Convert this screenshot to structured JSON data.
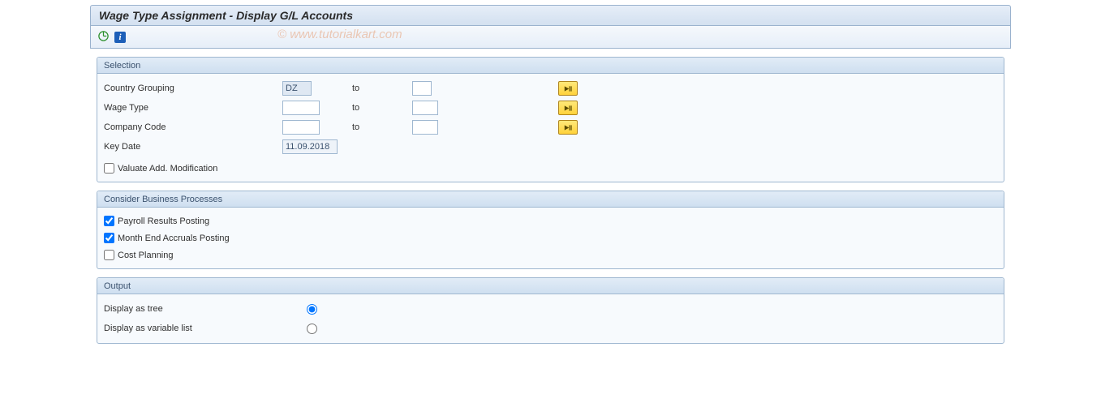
{
  "title": "Wage Type Assignment - Display G/L Accounts",
  "watermark": "© www.tutorialkart.com",
  "toolbar": {
    "execute_icon": "execute",
    "info_icon": "i"
  },
  "groups": {
    "selection": {
      "heading": "Selection",
      "fields": {
        "country_grouping": {
          "label": "Country Grouping",
          "from": "DZ",
          "to_label": "to",
          "to": ""
        },
        "wage_type": {
          "label": "Wage Type",
          "from": "",
          "to_label": "to",
          "to": ""
        },
        "company_code": {
          "label": "Company Code",
          "from": "",
          "to_label": "to",
          "to": ""
        },
        "key_date": {
          "label": "Key Date",
          "value": "11.09.2018"
        }
      },
      "valuate_label": "Valuate Add. Modification",
      "valuate_checked": false
    },
    "processes": {
      "heading": "Consider Business Processes",
      "items": [
        {
          "label": "Payroll Results Posting",
          "checked": true
        },
        {
          "label": "Month End Accruals Posting",
          "checked": true
        },
        {
          "label": "Cost Planning",
          "checked": false
        }
      ]
    },
    "output": {
      "heading": "Output",
      "options": [
        {
          "label": "Display as tree",
          "selected": true
        },
        {
          "label": "Display as variable list",
          "selected": false
        }
      ]
    }
  }
}
